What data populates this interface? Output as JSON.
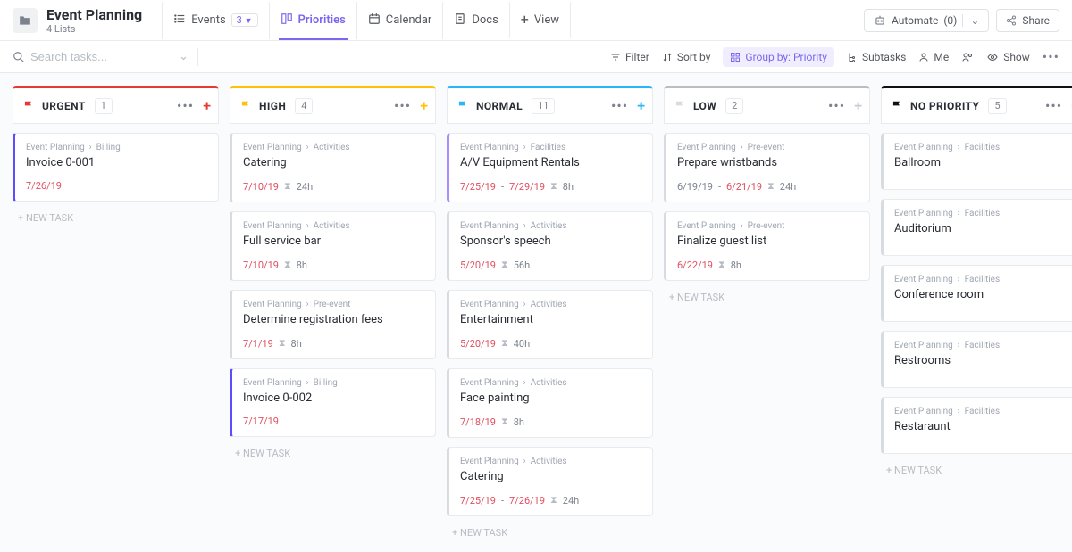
{
  "header": {
    "title": "Event Planning",
    "subtitle": "4 Lists",
    "views": [
      {
        "label": "Events",
        "icon": "list-icon",
        "badge": "3",
        "dropdown": true,
        "active": false
      },
      {
        "label": "Priorities",
        "icon": "board-icon",
        "active": true
      },
      {
        "label": "Calendar",
        "icon": "calendar-icon",
        "active": false
      },
      {
        "label": "Docs",
        "icon": "doc-icon",
        "active": false
      },
      {
        "label": "View",
        "icon": "plus-icon",
        "active": false
      }
    ],
    "automate": {
      "label": "Automate",
      "count": "(0)"
    },
    "share": "Share"
  },
  "toolbar": {
    "search_placeholder": "Search tasks...",
    "filter": "Filter",
    "sort": "Sort by",
    "group": "Group by: Priority",
    "subtasks": "Subtasks",
    "me": "Me",
    "show": "Show"
  },
  "new_task_label": "+ NEW TASK",
  "columns": [
    {
      "name": "URGENT",
      "count": "1",
      "color": "#e53935",
      "flag_fill": "#e53935",
      "plus_color": "#e53935",
      "cards": [
        {
          "breadcrumb": [
            "Event Planning",
            "Billing"
          ],
          "title": "Invoice 0-001",
          "date_start": "7/26/19",
          "estimate": "",
          "border": "#5c4dff"
        }
      ]
    },
    {
      "name": "HIGH",
      "count": "4",
      "color": "#ffc107",
      "flag_fill": "#ffc107",
      "plus_color": "#ffc107",
      "cards": [
        {
          "breadcrumb": [
            "Event Planning",
            "Activities"
          ],
          "title": "Catering",
          "date_start": "7/10/19",
          "estimate": "24h",
          "border": "#d8dbe0"
        },
        {
          "breadcrumb": [
            "Event Planning",
            "Activities"
          ],
          "title": "Full service bar",
          "date_start": "7/10/19",
          "estimate": "8h",
          "border": "#d8dbe0"
        },
        {
          "breadcrumb": [
            "Event Planning",
            "Pre-event"
          ],
          "title": "Determine registration fees",
          "date_start": "7/1/19",
          "estimate": "8h",
          "border": "#d8dbe0"
        },
        {
          "breadcrumb": [
            "Event Planning",
            "Billing"
          ],
          "title": "Invoice 0-002",
          "date_start": "7/17/19",
          "estimate": "",
          "border": "#5c4dff"
        }
      ]
    },
    {
      "name": "NORMAL",
      "count": "11",
      "color": "#29b6f6",
      "flag_fill": "#29b6f6",
      "plus_color": "#29b6f6",
      "cards": [
        {
          "breadcrumb": [
            "Event Planning",
            "Facilities"
          ],
          "title": "A/V Equipment Rentals",
          "date_start": "7/25/19",
          "date_end": "7/29/19",
          "estimate": "8h",
          "border": "#a98eff"
        },
        {
          "breadcrumb": [
            "Event Planning",
            "Activities"
          ],
          "title": "Sponsor's speech",
          "date_start": "5/20/19",
          "estimate": "56h",
          "border": "#d8dbe0"
        },
        {
          "breadcrumb": [
            "Event Planning",
            "Activities"
          ],
          "title": "Entertainment",
          "date_start": "5/20/19",
          "estimate": "40h",
          "border": "#d8dbe0"
        },
        {
          "breadcrumb": [
            "Event Planning",
            "Activities"
          ],
          "title": "Face painting",
          "date_start": "7/18/19",
          "estimate": "8h",
          "border": "#d8dbe0"
        },
        {
          "breadcrumb": [
            "Event Planning",
            "Activities"
          ],
          "title": "Catering",
          "date_start": "7/25/19",
          "date_end": "7/26/19",
          "estimate": "24h",
          "border": "#d8dbe0"
        }
      ]
    },
    {
      "name": "LOW",
      "count": "2",
      "color": "#bdbdbd",
      "flag_fill": "#d8dbe0",
      "plus_color": "#c7ccd4",
      "cards": [
        {
          "breadcrumb": [
            "Event Planning",
            "Pre-event"
          ],
          "title": "Prepare wristbands",
          "date_start": "6/19/19",
          "date_end": "6/21/19",
          "estimate": "24h",
          "border": "#d8dbe0",
          "date_start_muted": true
        },
        {
          "breadcrumb": [
            "Event Planning",
            "Pre-event"
          ],
          "title": "Finalize guest list",
          "date_start": "6/22/19",
          "estimate": "8h",
          "border": "#d8dbe0"
        }
      ]
    },
    {
      "name": "NO PRIORITY",
      "count": "5",
      "color": "#111111",
      "flag_fill": "#111111",
      "plus_color": "#c7ccd4",
      "cards": [
        {
          "breadcrumb": [
            "Event Planning",
            "Facilities"
          ],
          "title": "Ballroom",
          "border": "#d8dbe0"
        },
        {
          "breadcrumb": [
            "Event Planning",
            "Facilities"
          ],
          "title": "Auditorium",
          "border": "#d8dbe0"
        },
        {
          "breadcrumb": [
            "Event Planning",
            "Facilities"
          ],
          "title": "Conference room",
          "border": "#d8dbe0"
        },
        {
          "breadcrumb": [
            "Event Planning",
            "Facilities"
          ],
          "title": "Restrooms",
          "border": "#d8dbe0"
        },
        {
          "breadcrumb": [
            "Event Planning",
            "Facilities"
          ],
          "title": "Restaraunt",
          "border": "#d8dbe0"
        }
      ]
    }
  ]
}
